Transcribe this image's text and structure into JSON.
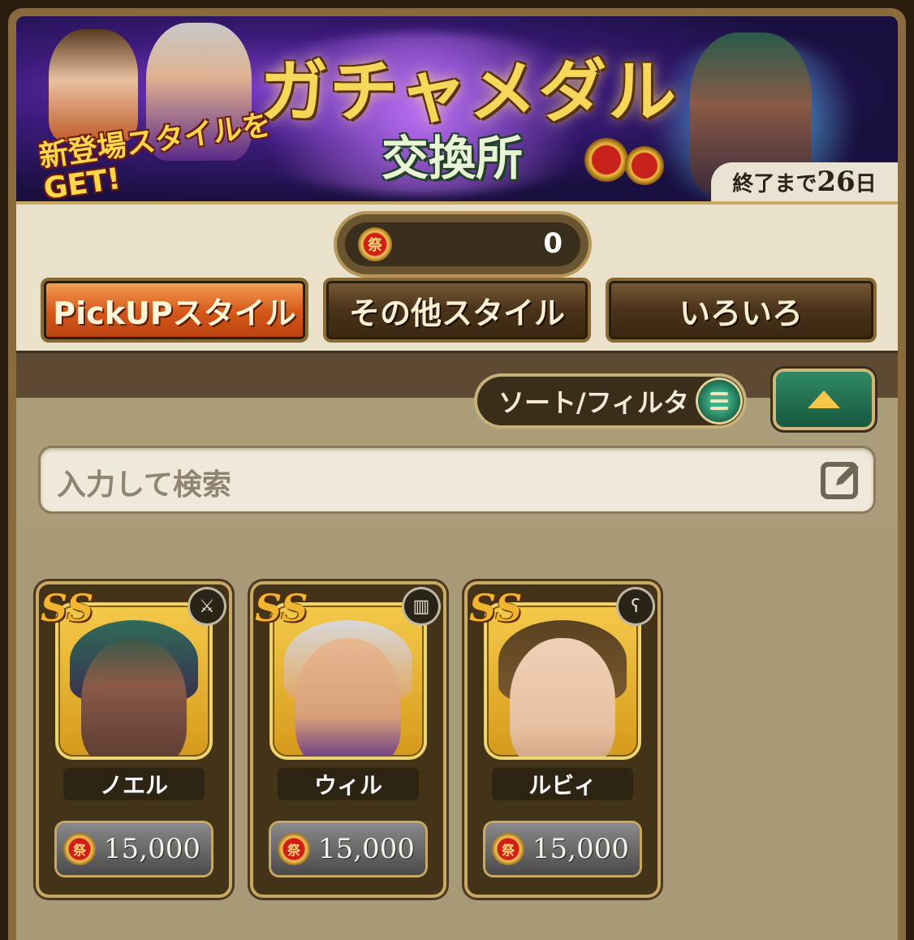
{
  "banner": {
    "title": "ガチャメダル",
    "subtitle": "交換所",
    "promo": "新登場スタイルをGET!",
    "countdown_prefix": "終了まで",
    "countdown_days": "26",
    "countdown_unit": "日",
    "medal_glyph": "祭"
  },
  "currency": {
    "icon": "medal-icon",
    "icon_glyph": "祭",
    "count": "0"
  },
  "tabs": [
    {
      "label": "PickUPスタイル",
      "active": true
    },
    {
      "label": "その他スタイル",
      "active": false
    },
    {
      "label": "いろいろ",
      "active": false
    }
  ],
  "sort_filter": {
    "label": "ソート/フィルタ",
    "icon": "list-icon"
  },
  "collapse_button": {
    "icon": "triangle-up-icon"
  },
  "search": {
    "placeholder": "入力して検索",
    "icon": "edit-icon"
  },
  "cards": [
    {
      "rank": "SS",
      "name": "ノエル",
      "price": "15,000",
      "weapon_icon": "sword-icon",
      "weapon_glyph": "⚔"
    },
    {
      "rank": "SS",
      "name": "ウィル",
      "price": "15,000",
      "weapon_icon": "club-icon",
      "weapon_glyph": "▥"
    },
    {
      "rank": "SS",
      "name": "ルビィ",
      "price": "15,000",
      "weapon_icon": "staff-icon",
      "weapon_glyph": "ʕ"
    }
  ],
  "colors": {
    "tab_active": "#d4571a",
    "tab_inactive": "#4a331a",
    "accent_green": "#1d6a4e",
    "gold": "#c7a865"
  }
}
